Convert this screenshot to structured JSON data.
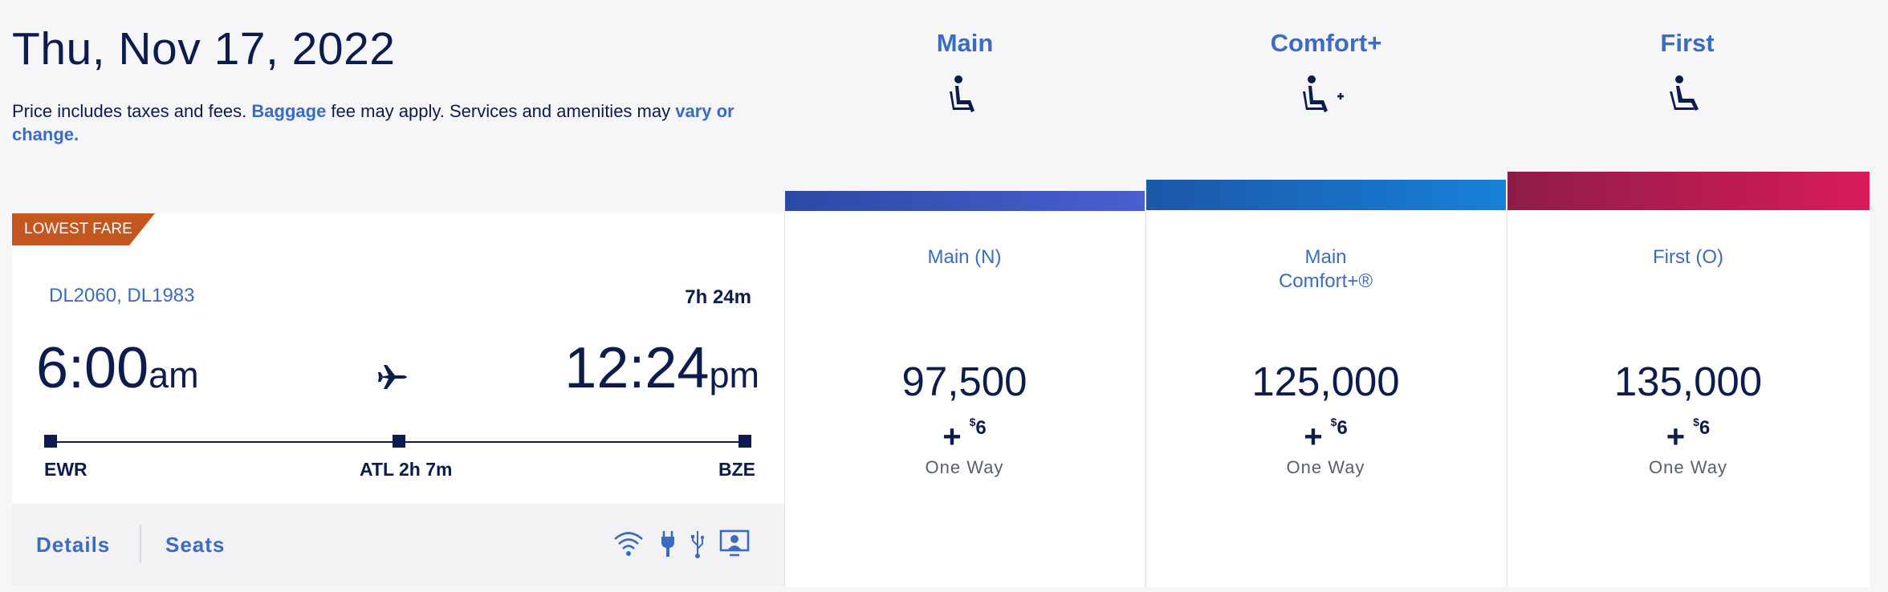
{
  "header": {
    "date": "Thu, Nov 17, 2022",
    "note_prefix": "Price includes taxes and fees. ",
    "note_link1": "Baggage",
    "note_mid": " fee may apply. Services and amenities may ",
    "note_link2": "vary or change."
  },
  "cabins": [
    {
      "label": "Main",
      "icon": "seat-icon"
    },
    {
      "label": "Comfort+",
      "icon": "seat-plus-icon"
    },
    {
      "label": "First",
      "icon": "seat-icon"
    }
  ],
  "flight": {
    "badge": "LOWEST FARE",
    "flight1": "DL2060",
    "flight_sep": ", ",
    "flight2": "DL1983",
    "duration": "7h 24m",
    "depart_time": "6:00",
    "depart_ampm": "am",
    "arrive_time": "12:24",
    "arrive_ampm": "pm",
    "origin": "EWR",
    "layover": "ATL 2h 7m",
    "destination": "BZE",
    "details_label": "Details",
    "seats_label": "Seats",
    "amenities": [
      "wifi-icon",
      "power-icon",
      "usb-icon",
      "entertainment-icon"
    ]
  },
  "fares": [
    {
      "title": "Main (N)",
      "miles": "97,500",
      "plus": "+",
      "currency": "$",
      "fee": "6",
      "trip": "One Way",
      "color_from": "#2a4aa6",
      "color_to": "#4a5fd0"
    },
    {
      "title": "Main Comfort+®",
      "title_line1": "Main",
      "title_line2": "Comfort+®",
      "miles": "125,000",
      "plus": "+",
      "currency": "$",
      "fee": "6",
      "trip": "One Way",
      "color_from": "#1c57a8",
      "color_to": "#1681d8"
    },
    {
      "title": "First (O)",
      "miles": "135,000",
      "plus": "+",
      "currency": "$",
      "fee": "6",
      "trip": "One Way",
      "color_from": "#8e1c48",
      "color_to": "#d81b5a"
    }
  ]
}
